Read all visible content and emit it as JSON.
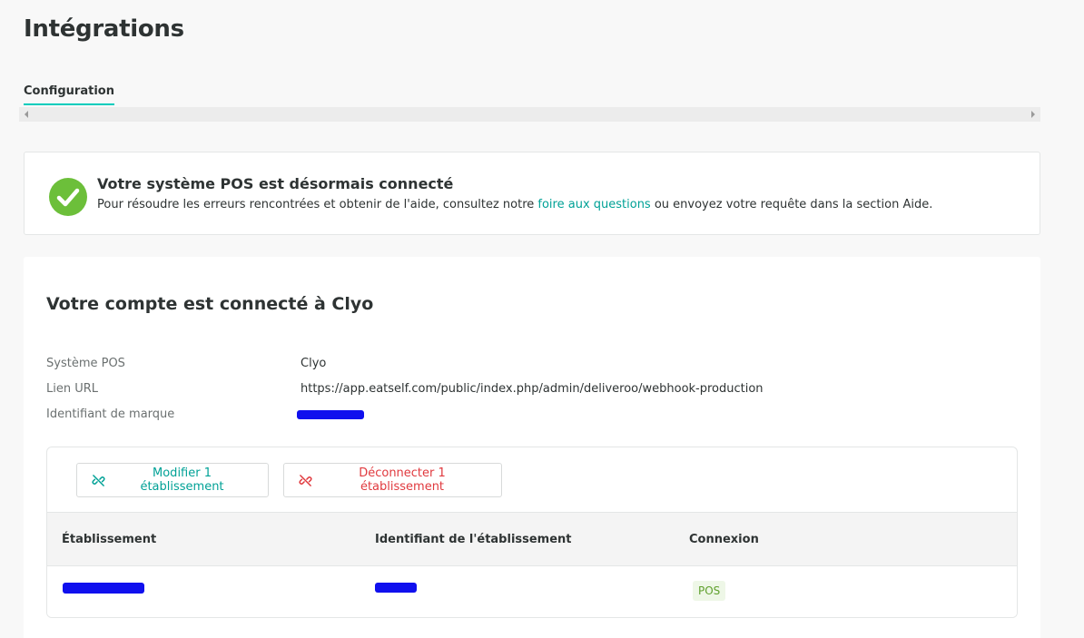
{
  "page": {
    "title": "Intégrations"
  },
  "tabs": [
    {
      "label": "Configuration",
      "active": true
    }
  ],
  "alert": {
    "icon": "check-circle-icon",
    "icon_color": "#6cbf3a",
    "title": "Votre système POS est désormais connecté",
    "text_before": "Pour résoudre les erreurs rencontrées et obtenir de l'aide, consultez notre ",
    "link_text": "foire aux questions",
    "text_after": " ou envoyez votre requête dans la section Aide."
  },
  "account": {
    "title": "Votre compte est connecté à Clyo",
    "fields": [
      {
        "label": "Système POS",
        "value": "Clyo"
      },
      {
        "label": "Lien URL",
        "value": "https://app.eatself.com/public/index.php/admin/deliveroo/webhook-production"
      },
      {
        "label": "Identifiant de marque",
        "value": ""
      }
    ]
  },
  "actions": {
    "modify_label": "Modifier 1 établissement",
    "modify_icon": "unlink-icon",
    "disconnect_label": "Déconnecter 1 établissement",
    "disconnect_icon": "unlink-icon"
  },
  "table": {
    "columns": [
      "Établissement",
      "Identifiant de l'établissement",
      "Connexion"
    ],
    "rows": [
      {
        "name": "",
        "id": "",
        "connection": "POS"
      }
    ]
  },
  "colors": {
    "accent": "#00a196",
    "danger": "#e0393e",
    "success": "#6cbf3a",
    "tab_underline": "#00ccbc"
  }
}
